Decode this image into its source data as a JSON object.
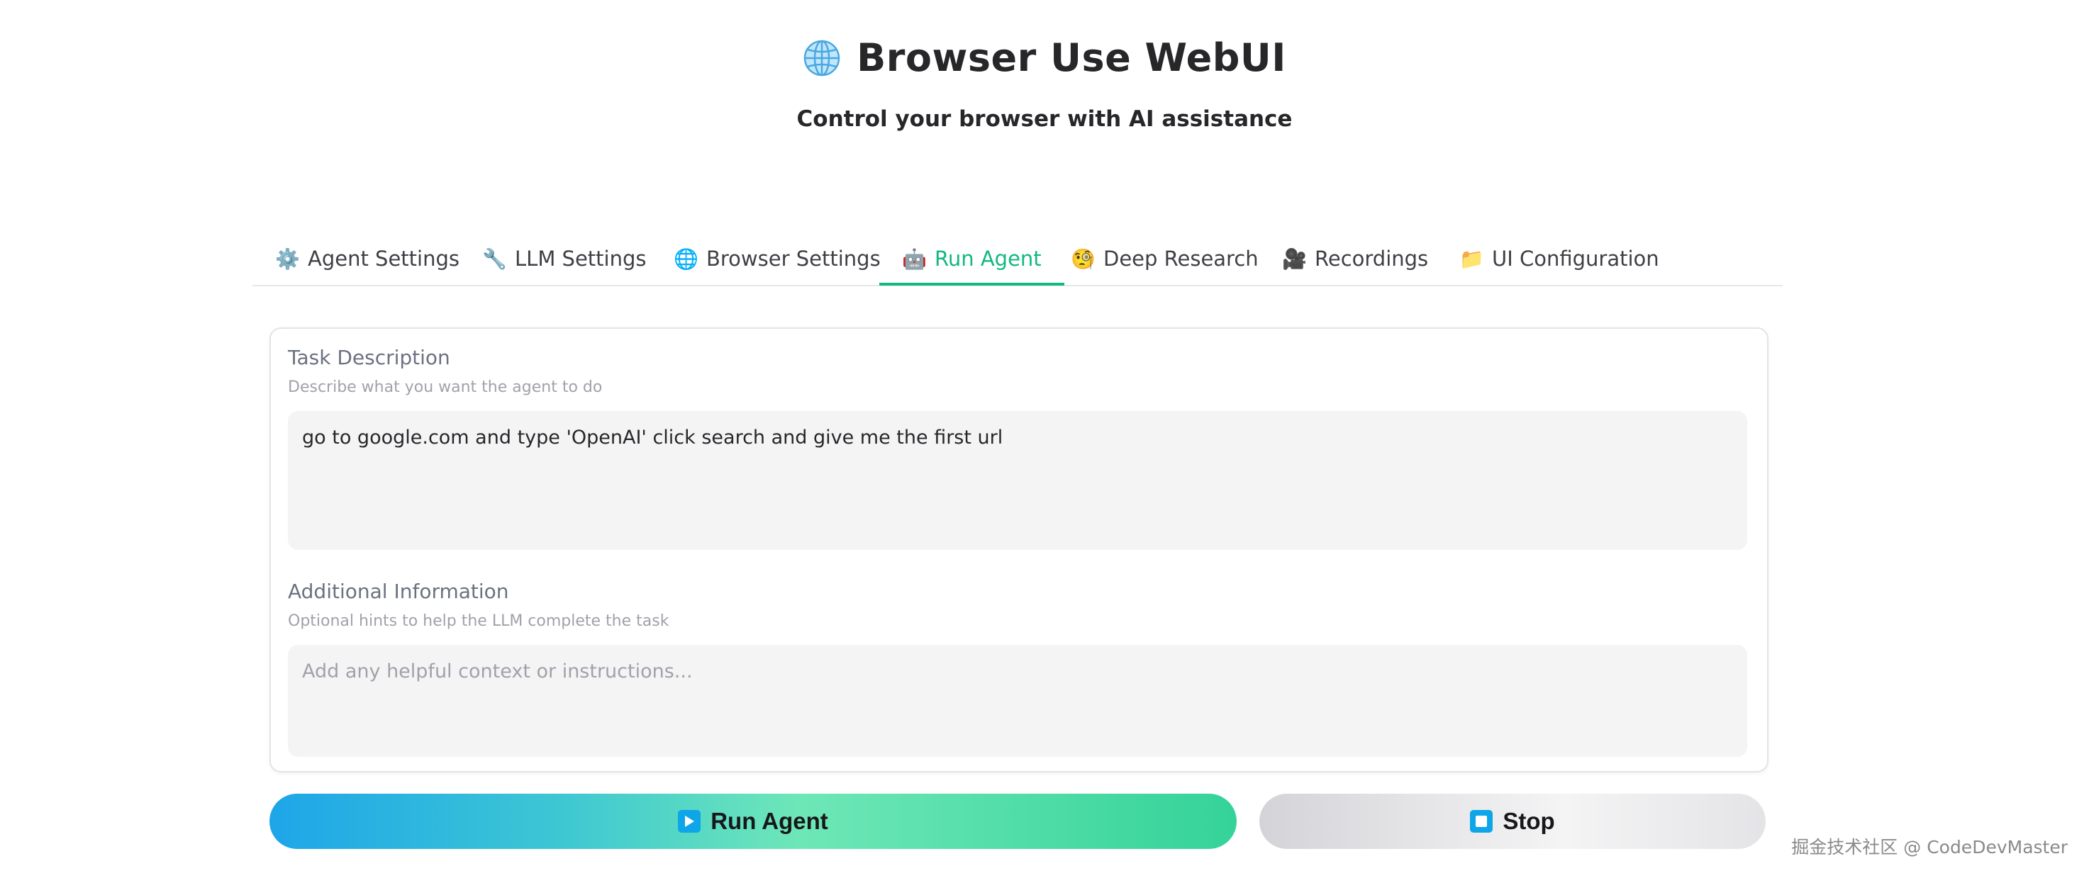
{
  "app": {
    "title": "Browser Use WebUI",
    "subtitle": "Control your browser with AI assistance",
    "title_icon": "globe-icon"
  },
  "tabs": [
    {
      "label": "Agent Settings",
      "icon": "⚙️",
      "icon_name": "gear-icon",
      "active": false
    },
    {
      "label": "LLM Settings",
      "icon": "🔧",
      "icon_name": "wrench-icon",
      "active": false
    },
    {
      "label": "Browser Settings",
      "icon": "🌐",
      "icon_name": "globe-icon",
      "active": false
    },
    {
      "label": "Run Agent",
      "icon": "🤖",
      "icon_name": "robot-icon",
      "active": true
    },
    {
      "label": "Deep Research",
      "icon": "🧐",
      "icon_name": "monocle-face-icon",
      "active": false
    },
    {
      "label": "Recordings",
      "icon": "🎥",
      "icon_name": "movie-camera-icon",
      "active": false
    },
    {
      "label": "UI Configuration",
      "icon": "📁",
      "icon_name": "folder-icon",
      "active": false
    }
  ],
  "task": {
    "label": "Task Description",
    "hint": "Describe what you want the agent to do",
    "value": "go to google.com and type 'OpenAI' click search and give me the first url"
  },
  "additional": {
    "label": "Additional Information",
    "hint": "Optional hints to help the LLM complete the task",
    "placeholder": "Add any helpful context or instructions..."
  },
  "buttons": {
    "run_label": "Run Agent",
    "stop_label": "Stop"
  },
  "watermark": "掘金技术社区 @ CodeDevMaster",
  "colors": {
    "accent": "#10b981",
    "run_gradient_start": "#1ea5e9",
    "run_gradient_end": "#34d399",
    "icon_blue": "#0ea5e9"
  }
}
